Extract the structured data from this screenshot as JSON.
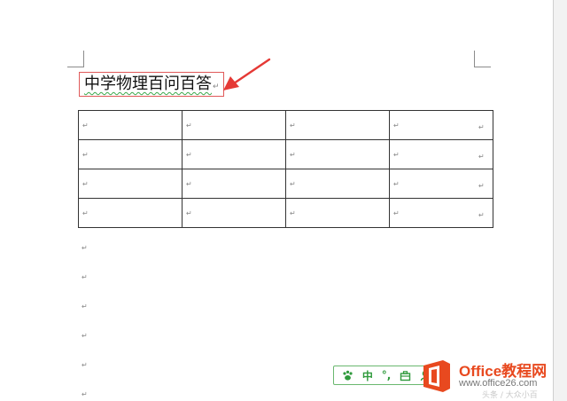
{
  "document": {
    "title": "中学物理百问百答",
    "paragraph_mark": "↵",
    "table": {
      "rows": [
        [
          "↵",
          "↵",
          "↵",
          "↵"
        ],
        [
          "↵",
          "↵",
          "↵",
          "↵"
        ],
        [
          "↵",
          "↵",
          "↵",
          "↵"
        ],
        [
          "↵",
          "↵",
          "↵",
          "↵"
        ]
      ],
      "row_end_marks": [
        "↵",
        "↵",
        "↵",
        "↵"
      ]
    },
    "empty_paragraphs": [
      "↵",
      "↵",
      "↵",
      "↵",
      "↵",
      "↵"
    ]
  },
  "annotation": {
    "arrow_color": "#e53935",
    "title_box_color": "#e05a5a"
  },
  "ime_toolbar": {
    "items": [
      {
        "icon": "paw-icon"
      },
      {
        "label": "中"
      },
      {
        "label": "°,"
      },
      {
        "icon": "toolbox-icon"
      },
      {
        "icon": "user-icon"
      }
    ],
    "color": "#2f9a3c"
  },
  "watermark": {
    "title": "Office教程网",
    "url": "www.office26.com",
    "faded_text": "头条 / 大众小百",
    "brand_color": "#e8491f"
  }
}
